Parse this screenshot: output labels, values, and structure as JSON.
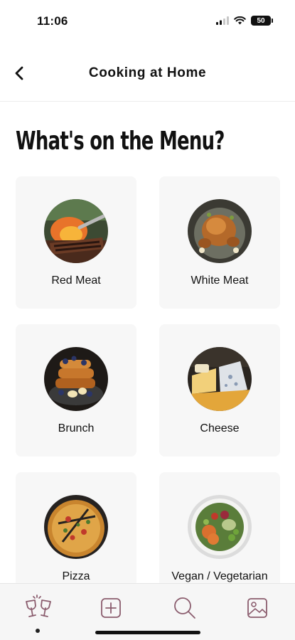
{
  "status_bar": {
    "time": "11:06",
    "battery": "50",
    "icons": [
      "signal-icon",
      "wifi-icon",
      "battery-icon"
    ]
  },
  "header": {
    "title": "Cooking at Home",
    "back_icon": "chevron-left-icon"
  },
  "page": {
    "title": "What's on the Menu?"
  },
  "categories": [
    {
      "label": "Red Meat",
      "image": "grilled-steak-photo"
    },
    {
      "label": "White Meat",
      "image": "roast-chicken-photo"
    },
    {
      "label": "Brunch",
      "image": "french-toast-photo"
    },
    {
      "label": "Cheese",
      "image": "cheese-board-photo"
    },
    {
      "label": "Pizza",
      "image": "pizza-photo"
    },
    {
      "label": "Vegan / Vegetarian",
      "image": "salad-bowl-photo"
    }
  ],
  "tab_bar": {
    "tabs": [
      {
        "icon": "wine-glasses-icon",
        "active": true
      },
      {
        "icon": "add-square-icon",
        "active": false
      },
      {
        "icon": "search-icon",
        "active": false
      },
      {
        "icon": "image-icon",
        "active": false
      }
    ],
    "icon_color": "#8b5d6e"
  }
}
